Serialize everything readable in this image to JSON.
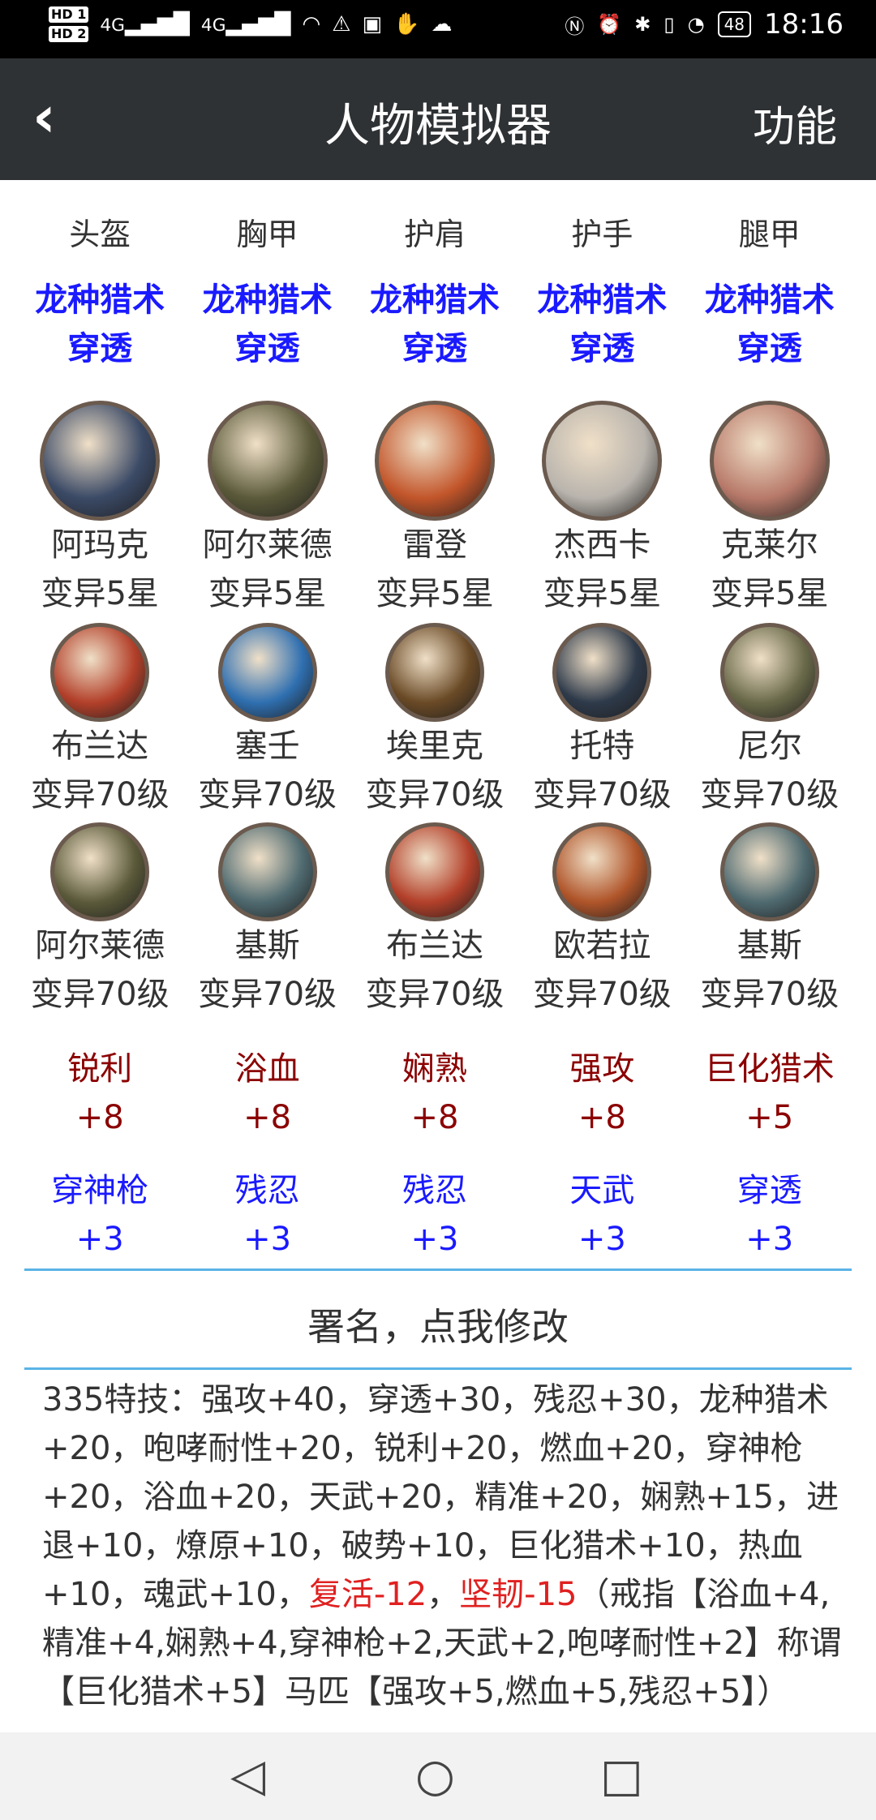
{
  "status": {
    "time": "18:16",
    "battery": "48",
    "hd1": "HD 1",
    "hd2": "HD 2",
    "net1": "4G",
    "net2": "4G"
  },
  "header": {
    "title": "人物模拟器",
    "action": "功能"
  },
  "slots": [
    "头盔",
    "胸甲",
    "护肩",
    "护手",
    "腿甲"
  ],
  "slot_skills": [
    {
      "line1": "龙种猎术",
      "line2": "穿透"
    },
    {
      "line1": "龙种猎术",
      "line2": "穿透"
    },
    {
      "line1": "龙种猎术",
      "line2": "穿透"
    },
    {
      "line1": "龙种猎术",
      "line2": "穿透"
    },
    {
      "line1": "龙种猎术",
      "line2": "穿透"
    }
  ],
  "heroes_row1": [
    {
      "name": "阿玛克",
      "level": "变异5星",
      "color": "#3b4a66"
    },
    {
      "name": "阿尔莱德",
      "level": "变异5星",
      "color": "#5b5a3a"
    },
    {
      "name": "雷登",
      "level": "变异5星",
      "color": "#c2552a"
    },
    {
      "name": "杰西卡",
      "level": "变异5星",
      "color": "#b9b4ad"
    },
    {
      "name": "克莱尔",
      "level": "变异5星",
      "color": "#b87a6a"
    }
  ],
  "heroes_row2": [
    {
      "name": "布兰达",
      "level": "变异70级",
      "color": "#b3402a"
    },
    {
      "name": "塞壬",
      "level": "变异70级",
      "color": "#2f6fb0"
    },
    {
      "name": "埃里克",
      "level": "变异70级",
      "color": "#6a4a26"
    },
    {
      "name": "托特",
      "level": "变异70级",
      "color": "#2e3a4a"
    },
    {
      "name": "尼尔",
      "level": "变异70级",
      "color": "#6a6a4a"
    }
  ],
  "heroes_row3": [
    {
      "name": "阿尔莱德",
      "level": "变异70级",
      "color": "#5b5a3a"
    },
    {
      "name": "基斯",
      "level": "变异70级",
      "color": "#4f6a70"
    },
    {
      "name": "布兰达",
      "level": "变异70级",
      "color": "#b3402a"
    },
    {
      "name": "欧若拉",
      "level": "变异70级",
      "color": "#b0552a"
    },
    {
      "name": "基斯",
      "level": "变异70级",
      "color": "#4f6a70"
    }
  ],
  "attrs_red": [
    {
      "name": "锐利",
      "val": "+8"
    },
    {
      "name": "浴血",
      "val": "+8"
    },
    {
      "name": "娴熟",
      "val": "+8"
    },
    {
      "name": "强攻",
      "val": "+8"
    },
    {
      "name": "巨化猎术",
      "val": "+5"
    }
  ],
  "attrs_blue": [
    {
      "name": "穿神枪",
      "val": "+3"
    },
    {
      "name": "残忍",
      "val": "+3"
    },
    {
      "name": "残忍",
      "val": "+3"
    },
    {
      "name": "天武",
      "val": "+3"
    },
    {
      "name": "穿透",
      "val": "+3"
    }
  ],
  "signature": "署名，点我修改",
  "summary": {
    "part1": "335特技：强攻+40，穿透+30，残忍+30，龙种猎术+20，咆哮耐性+20，锐利+20，燃血+20，穿神枪+20，浴血+20，天武+20，精准+20，娴熟+15，进退+10，燎原+10，破势+10，巨化猎术+10，热血+10，魂武+10，",
    "neg1": "复活-12",
    "sep": "，",
    "neg2": "坚韧-15",
    "part2": "（戒指【浴血+4,精准+4,娴熟+4,穿神枪+2,天武+2,咆哮耐性+2】称谓【巨化猎术+5】马匹【强攻+5,燃血+5,残忍+5】）"
  }
}
